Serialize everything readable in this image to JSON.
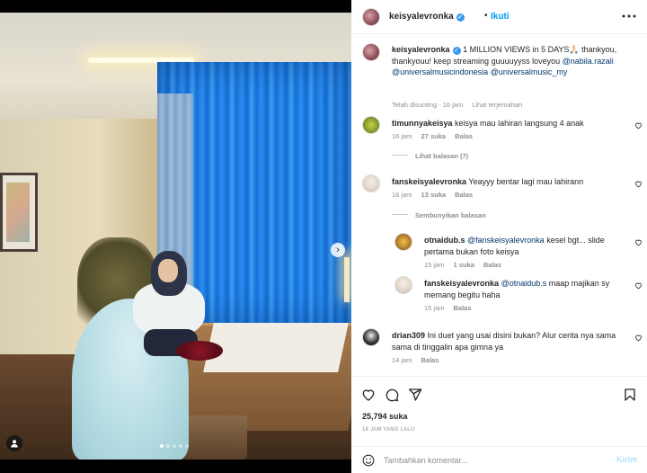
{
  "media": {
    "carousel_dots": 5,
    "active_dot": 0,
    "next_glyph": "›"
  },
  "header": {
    "username": "keisyalevronka",
    "separator": "•",
    "follow_label": "Ikuti"
  },
  "caption": {
    "username": "keisyalevronka",
    "text_before": "1 MILLION VIEWS in 5 DAYS🙏🏻 thankyou, thankyouu! keep streaming guuuuyyss loveyou ",
    "mention1": "@nabila.razali",
    "mention2": "@universalmusicindonesia",
    "mention3": "@universalmusic_my",
    "edited": "Telah disunting · 16 jam",
    "translate": "Lihat terjemahan"
  },
  "comments": [
    {
      "username": "timunnyakeisya",
      "text": "keisya mau lahiran langsung 4 anak",
      "time": "16 jam",
      "likes": "27 suka",
      "reply": "Balas",
      "toggle": "Lihat balasan (7)"
    },
    {
      "username": "fanskeisyalevronka",
      "text": "Yeayyy bentar lagi mau lahirann",
      "time": "16 jam",
      "likes": "13 suka",
      "reply": "Balas",
      "toggle": "Sembunyikan balasan",
      "replies": [
        {
          "username": "otnaidub.s",
          "mention": "@fanskeisyalevronka",
          "text": " kesel bgt... slide pertama bukan foto keisya",
          "time": "15 jam",
          "likes": "1 suka",
          "reply": "Balas"
        },
        {
          "username": "fanskeisyalevronka",
          "mention": "@otnaidub.s",
          "text": " maap majikan sy memang begitu haha",
          "time": "15 jam",
          "reply": "Balas"
        }
      ]
    },
    {
      "username": "drian309",
      "text": "Ini duet yang usai disini bukan? Alur cerita nya sama sama di tinggalin apa gimna ya",
      "time": "14 jam",
      "reply": "Balas"
    }
  ],
  "actions": {
    "likes": "25,794 suka",
    "time_ago": "16 JAM YANG LALU"
  },
  "add_comment": {
    "placeholder": "Tambahkan komentar...",
    "post_label": "Kirim"
  },
  "colors": {
    "link": "#00376b",
    "follow": "#0095f6",
    "verified": "#3897f0",
    "muted": "#8e8e8e"
  },
  "icons": [
    "more-icon",
    "heart-icon",
    "comment-icon",
    "share-icon",
    "bookmark-icon",
    "emoji-icon",
    "user-tag-icon",
    "next-arrow-icon",
    "verified-badge-icon"
  ]
}
